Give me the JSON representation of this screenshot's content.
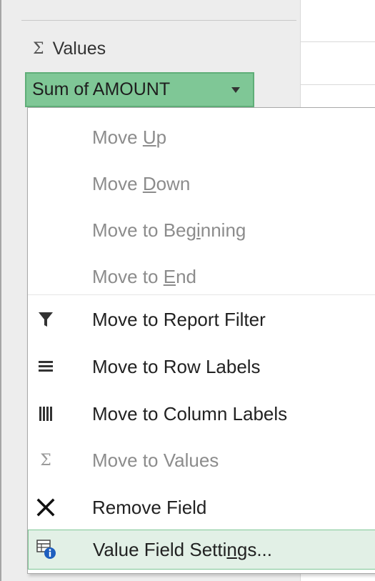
{
  "panel": {
    "values_label": "Values",
    "field_pill_label": "Sum of AMOUNT"
  },
  "menu": {
    "items": [
      {
        "pre": "Move ",
        "ul": "U",
        "post": "p",
        "disabled": true,
        "icon": ""
      },
      {
        "pre": "Move ",
        "ul": "D",
        "post": "own",
        "disabled": true,
        "icon": ""
      },
      {
        "pre": "Move to Beg",
        "ul": "i",
        "post": "nning",
        "disabled": true,
        "icon": ""
      },
      {
        "pre": "Move to ",
        "ul": "E",
        "post": "nd",
        "disabled": true,
        "icon": ""
      },
      {
        "pre": "Move to Report Filter",
        "ul": "",
        "post": "",
        "disabled": false,
        "icon": "filter-icon"
      },
      {
        "pre": "Move to Row Labels",
        "ul": "",
        "post": "",
        "disabled": false,
        "icon": "row-labels-icon"
      },
      {
        "pre": "Move to Column Labels",
        "ul": "",
        "post": "",
        "disabled": false,
        "icon": "column-labels-icon"
      },
      {
        "pre": "Move to Values",
        "ul": "",
        "post": "",
        "disabled": true,
        "icon": "sigma-icon"
      },
      {
        "pre": "Remove Field",
        "ul": "",
        "post": "",
        "disabled": false,
        "icon": "remove-x-icon"
      },
      {
        "pre": "Value Field Setti",
        "ul": "n",
        "post": "gs...",
        "disabled": false,
        "icon": "field-settings-icon"
      }
    ]
  },
  "colors": {
    "pill_fill": "#7fc796",
    "selected_bg": "#e2f0e6",
    "disabled_text": "#8c8c8c"
  }
}
